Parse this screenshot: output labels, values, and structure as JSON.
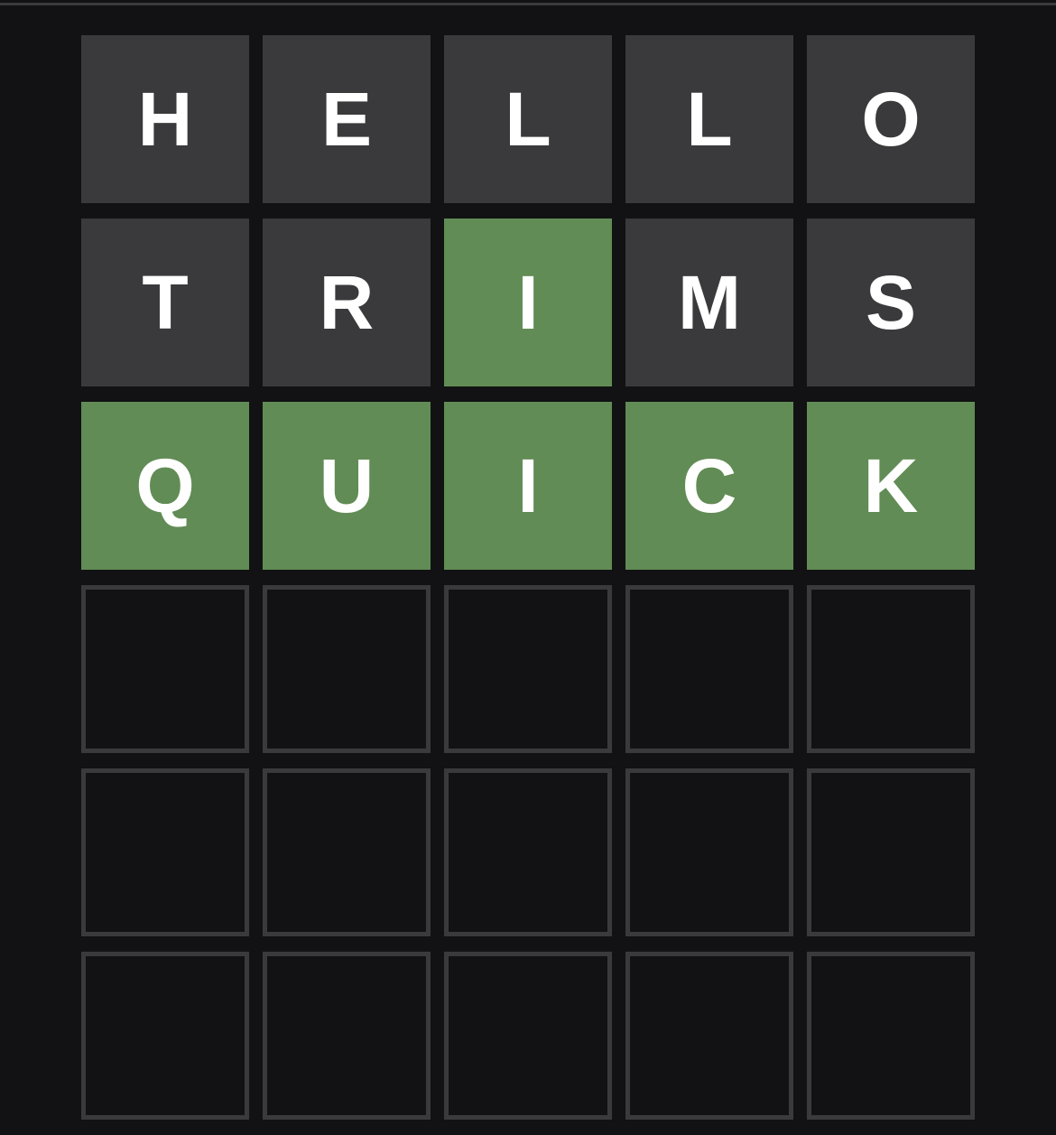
{
  "colors": {
    "background": "#121214",
    "absent": "#3a3a3c",
    "correct": "#618c55",
    "empty_border": "#3a3a3c",
    "letter": "#ffffff"
  },
  "board": {
    "rows": [
      [
        {
          "letter": "H",
          "state": "absent"
        },
        {
          "letter": "E",
          "state": "absent"
        },
        {
          "letter": "L",
          "state": "absent"
        },
        {
          "letter": "L",
          "state": "absent"
        },
        {
          "letter": "O",
          "state": "absent"
        }
      ],
      [
        {
          "letter": "T",
          "state": "absent"
        },
        {
          "letter": "R",
          "state": "absent"
        },
        {
          "letter": "I",
          "state": "correct"
        },
        {
          "letter": "M",
          "state": "absent"
        },
        {
          "letter": "S",
          "state": "absent"
        }
      ],
      [
        {
          "letter": "Q",
          "state": "correct"
        },
        {
          "letter": "U",
          "state": "correct"
        },
        {
          "letter": "I",
          "state": "correct"
        },
        {
          "letter": "C",
          "state": "correct"
        },
        {
          "letter": "K",
          "state": "correct"
        }
      ],
      [
        {
          "letter": "",
          "state": "empty"
        },
        {
          "letter": "",
          "state": "empty"
        },
        {
          "letter": "",
          "state": "empty"
        },
        {
          "letter": "",
          "state": "empty"
        },
        {
          "letter": "",
          "state": "empty"
        }
      ],
      [
        {
          "letter": "",
          "state": "empty"
        },
        {
          "letter": "",
          "state": "empty"
        },
        {
          "letter": "",
          "state": "empty"
        },
        {
          "letter": "",
          "state": "empty"
        },
        {
          "letter": "",
          "state": "empty"
        }
      ],
      [
        {
          "letter": "",
          "state": "empty"
        },
        {
          "letter": "",
          "state": "empty"
        },
        {
          "letter": "",
          "state": "empty"
        },
        {
          "letter": "",
          "state": "empty"
        },
        {
          "letter": "",
          "state": "empty"
        }
      ]
    ]
  }
}
